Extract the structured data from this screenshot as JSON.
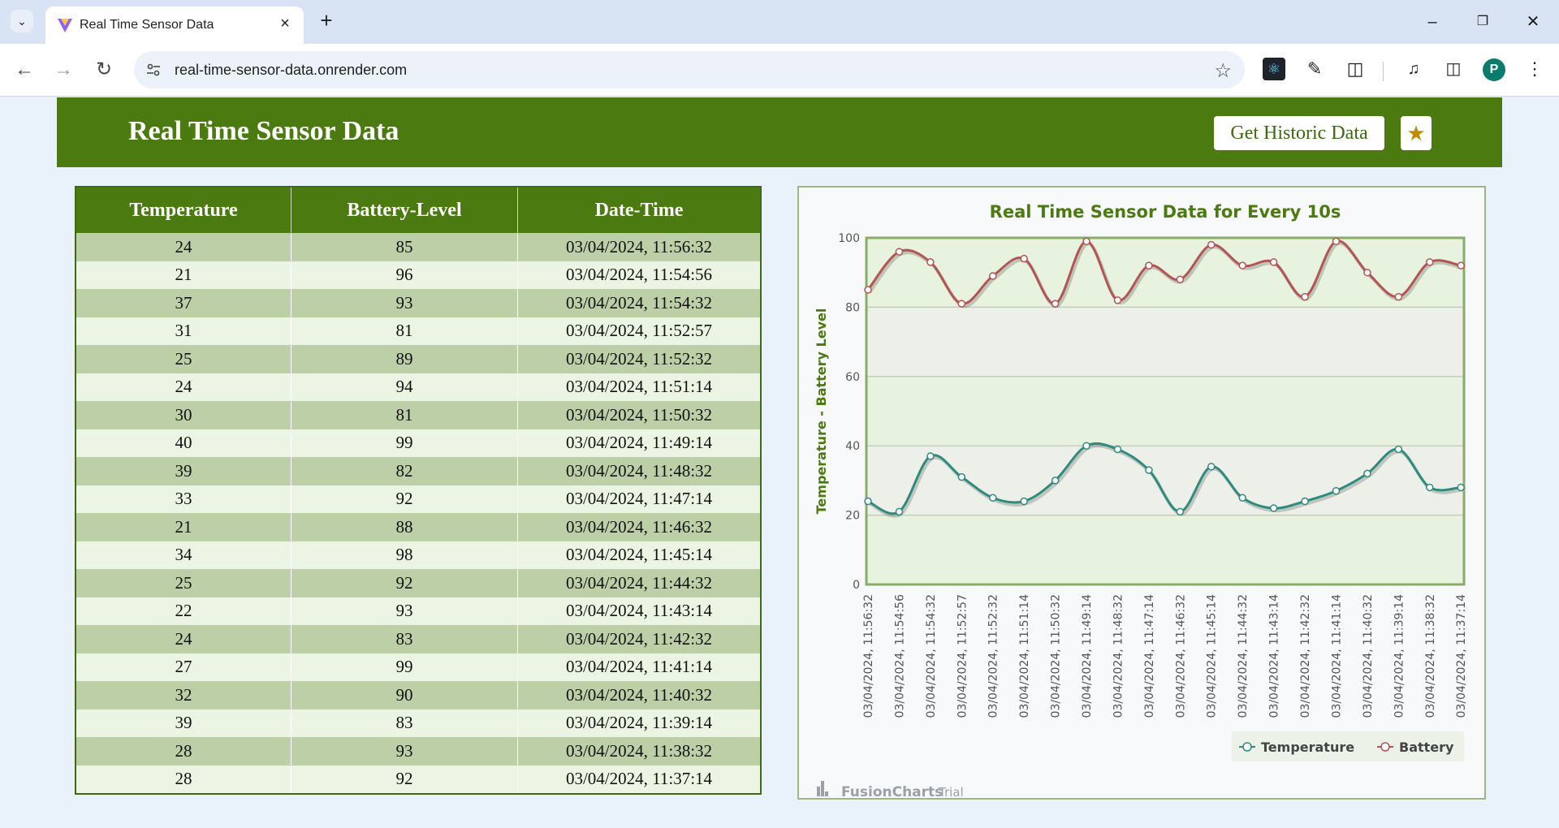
{
  "browser": {
    "tab_title": "Real Time Sensor Data",
    "url": "real-time-sensor-data.onrender.com",
    "profile_initial": "P",
    "icons": [
      "tab-list-icon",
      "favicon-icon",
      "close-icon",
      "plus-icon",
      "minimize-icon",
      "restore-icon",
      "close-window-icon",
      "back-arrow-icon",
      "forward-arrow-icon",
      "reload-icon",
      "site-info-icon",
      "star-icon",
      "react-devtools-icon",
      "eyedropper-icon",
      "extensions-icon",
      "media-icon",
      "side-panel-icon"
    ]
  },
  "header": {
    "title": "Real Time Sensor Data",
    "historic_button": "Get Historic Data",
    "accent": "#4b7b10"
  },
  "table": {
    "columns": [
      "Temperature",
      "Battery-Level",
      "Date-Time"
    ],
    "rows": [
      [
        "24",
        "85",
        "03/04/2024, 11:56:32"
      ],
      [
        "21",
        "96",
        "03/04/2024, 11:54:56"
      ],
      [
        "37",
        "93",
        "03/04/2024, 11:54:32"
      ],
      [
        "31",
        "81",
        "03/04/2024, 11:52:57"
      ],
      [
        "25",
        "89",
        "03/04/2024, 11:52:32"
      ],
      [
        "24",
        "94",
        "03/04/2024, 11:51:14"
      ],
      [
        "30",
        "81",
        "03/04/2024, 11:50:32"
      ],
      [
        "40",
        "99",
        "03/04/2024, 11:49:14"
      ],
      [
        "39",
        "82",
        "03/04/2024, 11:48:32"
      ],
      [
        "33",
        "92",
        "03/04/2024, 11:47:14"
      ],
      [
        "21",
        "88",
        "03/04/2024, 11:46:32"
      ],
      [
        "34",
        "98",
        "03/04/2024, 11:45:14"
      ],
      [
        "25",
        "92",
        "03/04/2024, 11:44:32"
      ],
      [
        "22",
        "93",
        "03/04/2024, 11:43:14"
      ],
      [
        "24",
        "83",
        "03/04/2024, 11:42:32"
      ],
      [
        "27",
        "99",
        "03/04/2024, 11:41:14"
      ],
      [
        "32",
        "90",
        "03/04/2024, 11:40:32"
      ],
      [
        "39",
        "83",
        "03/04/2024, 11:39:14"
      ],
      [
        "28",
        "93",
        "03/04/2024, 11:38:32"
      ],
      [
        "28",
        "92",
        "03/04/2024, 11:37:14"
      ]
    ]
  },
  "chart_data": {
    "type": "line",
    "title": "Real Time Sensor Data for Every 10s",
    "xlabel": "",
    "ylabel": "Temperature - Battery Level",
    "ylim": [
      0,
      100
    ],
    "yticks": [
      0,
      20,
      40,
      60,
      80,
      100
    ],
    "categories": [
      "03/04/2024, 11:56:32",
      "03/04/2024, 11:54:56",
      "03/04/2024, 11:54:32",
      "03/04/2024, 11:52:57",
      "03/04/2024, 11:52:32",
      "03/04/2024, 11:51:14",
      "03/04/2024, 11:50:32",
      "03/04/2024, 11:49:14",
      "03/04/2024, 11:48:32",
      "03/04/2024, 11:47:14",
      "03/04/2024, 11:46:32",
      "03/04/2024, 11:45:14",
      "03/04/2024, 11:44:32",
      "03/04/2024, 11:43:14",
      "03/04/2024, 11:42:32",
      "03/04/2024, 11:41:14",
      "03/04/2024, 11:40:32",
      "03/04/2024, 11:39:14",
      "03/04/2024, 11:38:32",
      "03/04/2024, 11:37:14"
    ],
    "series": [
      {
        "name": "Temperature",
        "color": "#2e8b80",
        "values": [
          24,
          21,
          37,
          31,
          25,
          24,
          30,
          40,
          39,
          33,
          21,
          34,
          25,
          22,
          24,
          27,
          32,
          39,
          28,
          28
        ]
      },
      {
        "name": "Battery",
        "color": "#b55454",
        "values": [
          85,
          96,
          93,
          81,
          89,
          94,
          81,
          99,
          82,
          92,
          88,
          98,
          92,
          93,
          83,
          99,
          90,
          83,
          93,
          92
        ]
      }
    ],
    "grid": true,
    "legend_position": "bottom-right",
    "watermark": "FusionCharts",
    "watermark_suffix": "Trial"
  }
}
